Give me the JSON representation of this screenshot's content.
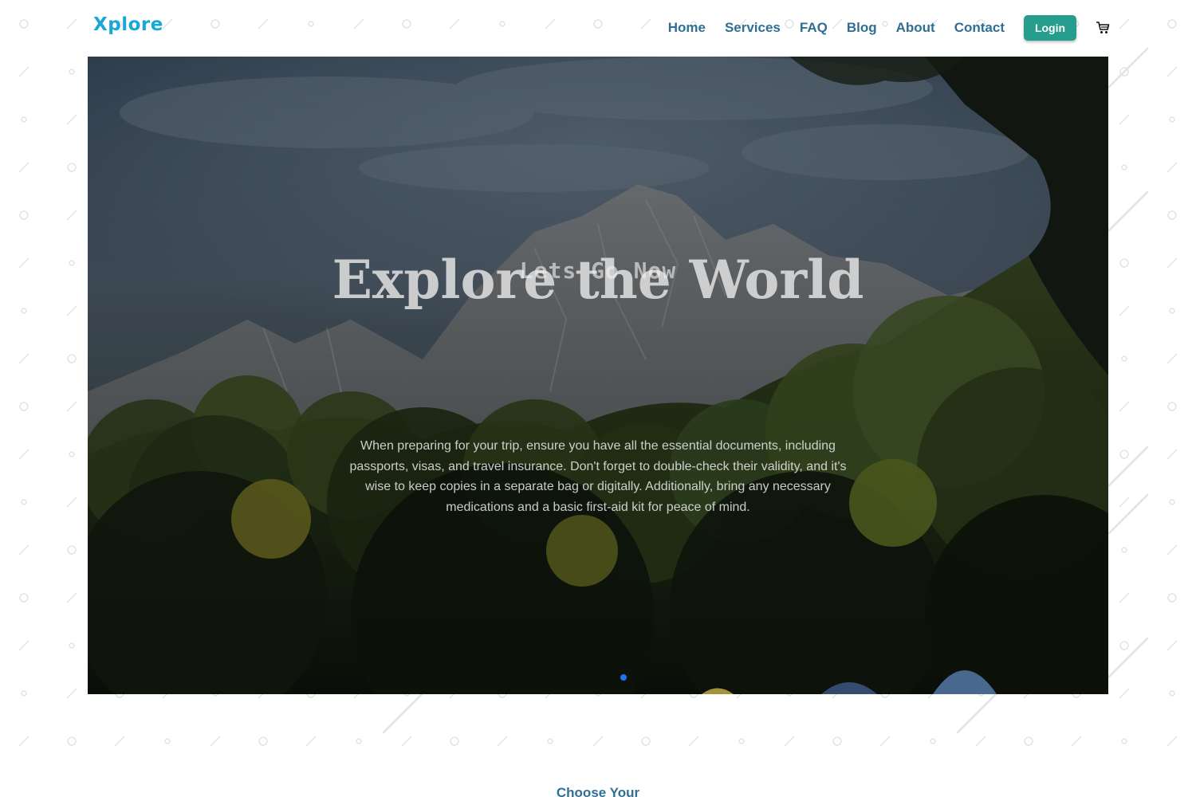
{
  "brand": {
    "name": "Xplore"
  },
  "nav": {
    "links": [
      "Home",
      "Services",
      "FAQ",
      "Blog",
      "About",
      "Contact"
    ],
    "login_label": "Login",
    "cart_icon": "cart-icon"
  },
  "hero": {
    "title": "Explore the World",
    "kicker": "Lets Go Now",
    "description": "When preparing for your trip, ensure you have all the essential documents, including passports, visas, and travel insurance. Don't forget to double-check their validity, and it's wise to keep copies in a separate bag or digitally. Additionally, bring any necessary medications and a basic first-aid kit for peace of mind.",
    "slide_count": 1,
    "active_slide": 1
  },
  "next_section": {
    "heading": "Choose Your"
  },
  "colors": {
    "brand": "#1aa7d6",
    "nav_text": "#2f6f93",
    "login_bg": "#279d8e",
    "active_dot": "#1877f2"
  }
}
